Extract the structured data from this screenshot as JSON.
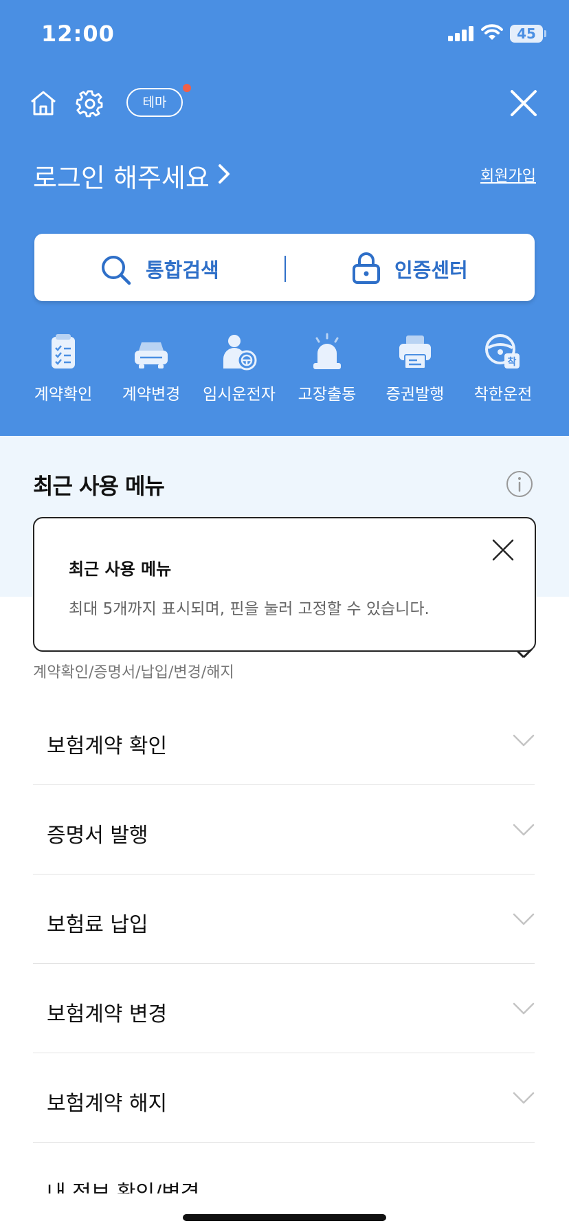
{
  "status_bar": {
    "time": "12:00",
    "battery": "45"
  },
  "header": {
    "theme_label": "테마",
    "login_prompt": "로그인 해주세요",
    "signup_link": "회원가입"
  },
  "search_card": {
    "search_label": "통합검색",
    "auth_label": "인증센터"
  },
  "quick_menu": [
    {
      "label": "계약확인",
      "icon": "contract-check-icon"
    },
    {
      "label": "계약변경",
      "icon": "car-change-icon"
    },
    {
      "label": "임시운전자",
      "icon": "temp-driver-icon"
    },
    {
      "label": "고장출동",
      "icon": "emergency-siren-icon"
    },
    {
      "label": "증권발행",
      "icon": "printer-icon"
    },
    {
      "label": "착한운전",
      "icon": "good-driving-icon"
    }
  ],
  "recent_menu": {
    "title": "최근 사용 메뉴",
    "tooltip": {
      "title": "최근 사용 메뉴",
      "description": "최대 5개까지 표시되며, 핀을 눌러 고정할 수 있습니다."
    }
  },
  "category_title": "계약확인/증명서/납입/변경/해지",
  "accordion": [
    {
      "label": "보험계약 확인"
    },
    {
      "label": "증명서 발행"
    },
    {
      "label": "보험료 납입"
    },
    {
      "label": "보험계약 변경"
    },
    {
      "label": "보험계약 해지"
    }
  ],
  "partial_item": "내 정보 확인/변경",
  "colors": {
    "primary": "#4a8fe3",
    "accent_text": "#2e6fc8",
    "notice_dot": "#f06048",
    "recent_bg": "#eef6fd"
  }
}
